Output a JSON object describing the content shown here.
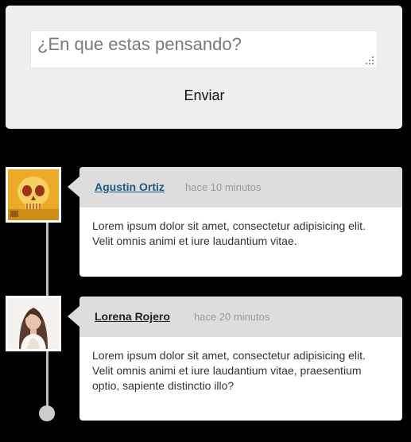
{
  "composer": {
    "placeholder": "¿En que estas pensando?",
    "send_label": "Enviar"
  },
  "posts": [
    {
      "author": "Agustin Ortiz",
      "author_color": "#1c5a82",
      "time": "hace 10 minutos",
      "text": "Lorem ipsum dolor sit amet, consectetur adipisicing elit. Velit omnis animi et iure laudantium vitae."
    },
    {
      "author": "Lorena Rojero",
      "author_color": "#222222",
      "time": "hace 20 minutos",
      "text": "Lorem ipsum dolor sit amet, consectetur adipisicing elit. Velit omnis animi et iure laudantium vitae, praesentium optio, sapiente distinctio illo?"
    }
  ]
}
